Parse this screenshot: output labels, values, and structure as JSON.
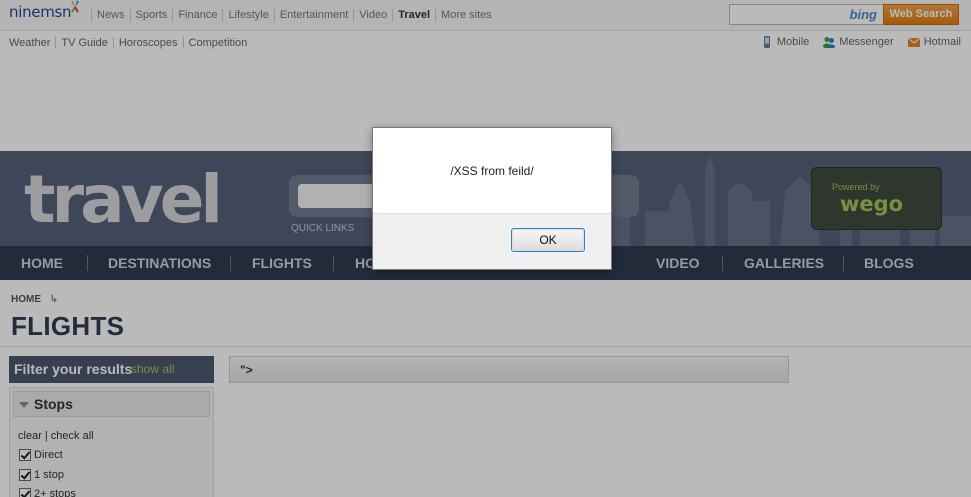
{
  "brand": {
    "logo": "ninemsn"
  },
  "top_nav": [
    "News",
    "Sports",
    "Finance",
    "Lifestyle",
    "Entertainment",
    "Video",
    "Travel",
    "More sites"
  ],
  "top_nav_active": "Travel",
  "search": {
    "provider": "bing",
    "button": "Web Search",
    "value": ""
  },
  "sub_nav": [
    "Weather",
    "TV Guide",
    "Horoscopes",
    "Competition"
  ],
  "right_links": [
    "Mobile",
    "Messenger",
    "Hotmail"
  ],
  "banner": {
    "logo_text": "travel",
    "quick_links": "QUICK LINKS",
    "partner": {
      "powered_by": "Powered by",
      "name": "wego"
    }
  },
  "main_nav": [
    "HOME",
    "DESTINATIONS",
    "FLIGHTS",
    "HO",
    "VIDEO",
    "GALLERIES",
    "BLOGS"
  ],
  "breadcrumb": "HOME",
  "page_title": "FLIGHTS",
  "filter": {
    "title": "Filter your results",
    "show_all": "show all",
    "stops_title": "Stops",
    "clear_check": "clear | check all",
    "options": [
      {
        "label": "Direct",
        "checked": true
      },
      {
        "label": "1 stop",
        "checked": true
      },
      {
        "label": "2+ stops",
        "checked": true
      }
    ]
  },
  "results": {
    "header": "\">"
  },
  "dialog": {
    "message": "/XSS from feild/",
    "ok": "OK"
  },
  "colors": {
    "nav_bg": "#2f3b50",
    "banner_bg": "#56627a",
    "accent_green": "#a6c55b",
    "search_orange": "#e07c12"
  }
}
